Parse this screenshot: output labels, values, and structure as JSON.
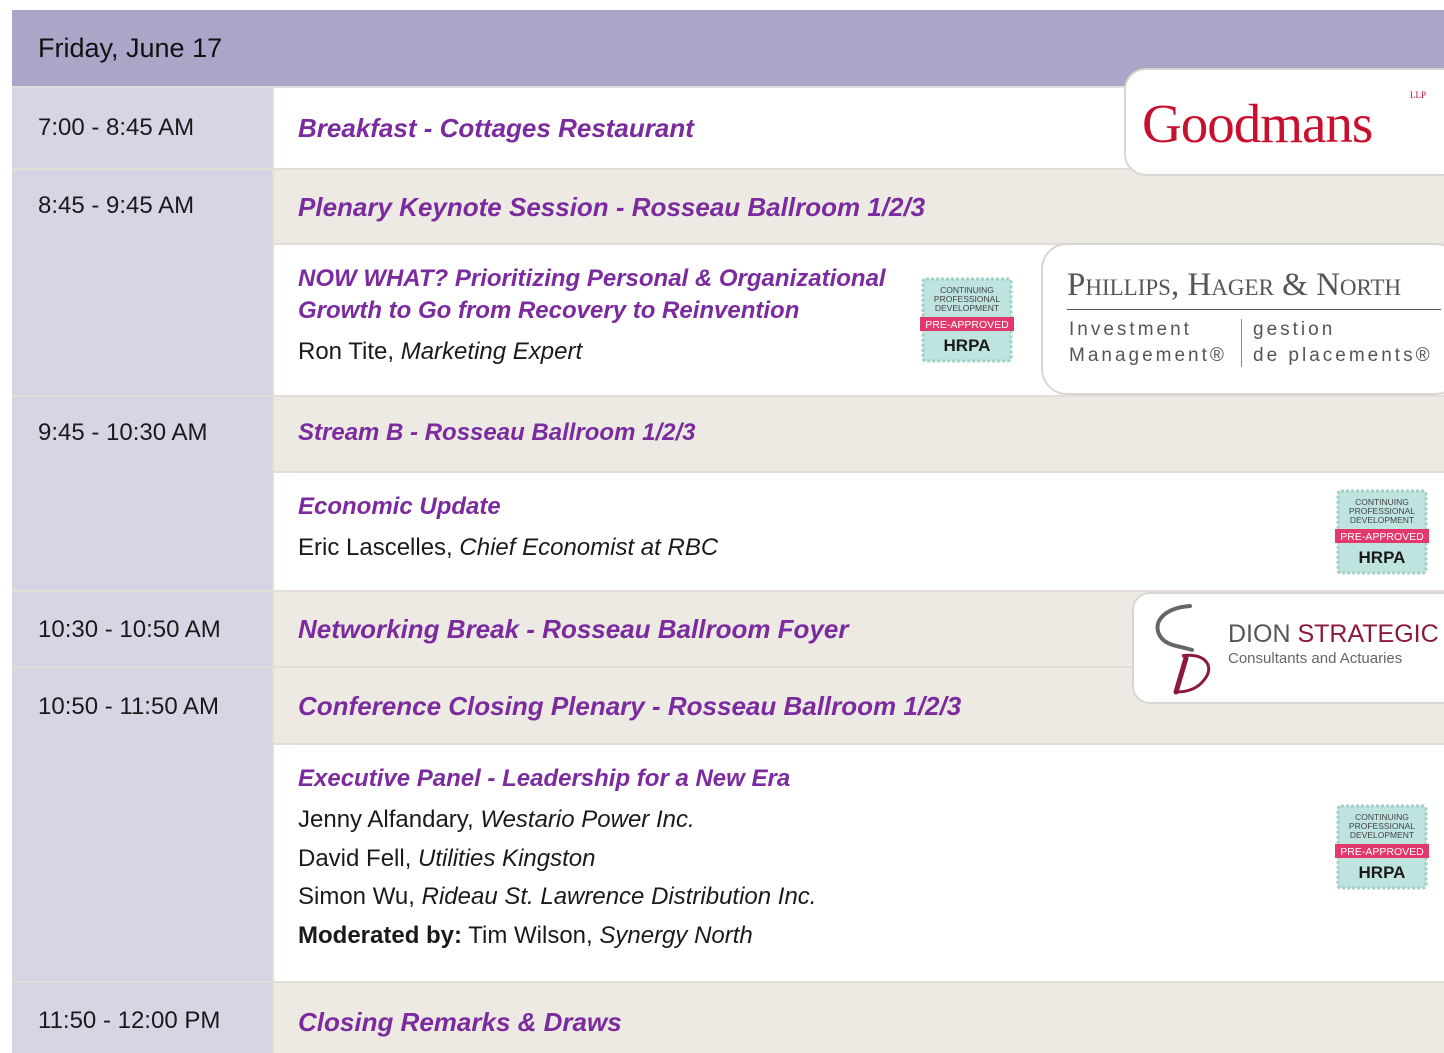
{
  "day_title": "Friday, June 17",
  "times": {
    "t1": "7:00 - 8:45 AM",
    "t2": "8:45 - 9:45 AM",
    "t3": "9:45 - 10:30 AM",
    "t4": "10:30 - 10:50 AM",
    "t5": "10:50 - 11:50 AM",
    "t6": "11:50 - 12:00 PM"
  },
  "sessions": {
    "breakfast": "Breakfast - Cottages Restaurant",
    "keynote": "Plenary Keynote Session - Rosseau Ballroom 1/2/3",
    "now_what_line1": "NOW WHAT? Prioritizing Personal & Organizational",
    "now_what_line2": "Growth to Go from Recovery to Reinvention",
    "stream_b": "Stream B - Rosseau Ballroom 1/2/3",
    "economic": "Economic Update",
    "networking": "Networking Break - Rosseau Ballroom Foyer",
    "closing_plenary": "Conference Closing Plenary - Rosseau Ballroom 1/2/3",
    "exec_panel": "Executive Panel - Leadership for a New Era",
    "closing_remarks": "Closing Remarks & Draws"
  },
  "speakers": {
    "ron_name": "Ron Tite, ",
    "ron_role": "Marketing Expert",
    "eric_name": "Eric Lascelles, ",
    "eric_role": "Chief Economist at RBC",
    "jenny_name": "Jenny Alfandary, ",
    "jenny_org": "Westario Power Inc.",
    "david_name": "David Fell, ",
    "david_org": "Utilities Kingston",
    "simon_name": "Simon Wu, ",
    "simon_org": "Rideau St. Lawrence Distribution Inc.",
    "moderated_label": "Moderated by:",
    "tim_name": " Tim Wilson, ",
    "tim_org": "Synergy North"
  },
  "badge": {
    "line1": "CONTINUING",
    "line2": "PROFESSIONAL",
    "line3": "DEVELOPMENT",
    "ribbon": "PRE-APPROVED",
    "org": "HRPA"
  },
  "logos": {
    "goodmans": "Goodmans",
    "goodmans_llp": "LLP",
    "phn_title": "Phillips, Hager & North",
    "phn_en1": "Investment",
    "phn_en2": "Management®",
    "phn_fr1": "gestion",
    "phn_fr2": "de placements®",
    "dion_1": "DION",
    "dion_2": "STRATEGIC",
    "dion_sub": "Consultants and Actuaries"
  },
  "colors": {
    "header": "#aaa6c8",
    "time_column": "#d7d5e4",
    "session_title": "#7b2b9e",
    "beige_row": "#edeae4",
    "goodmans_red": "#c8102e",
    "dion_maroon": "#8b1a3a",
    "badge_teal": "#bfe3df",
    "badge_ribbon": "#e2386b"
  }
}
